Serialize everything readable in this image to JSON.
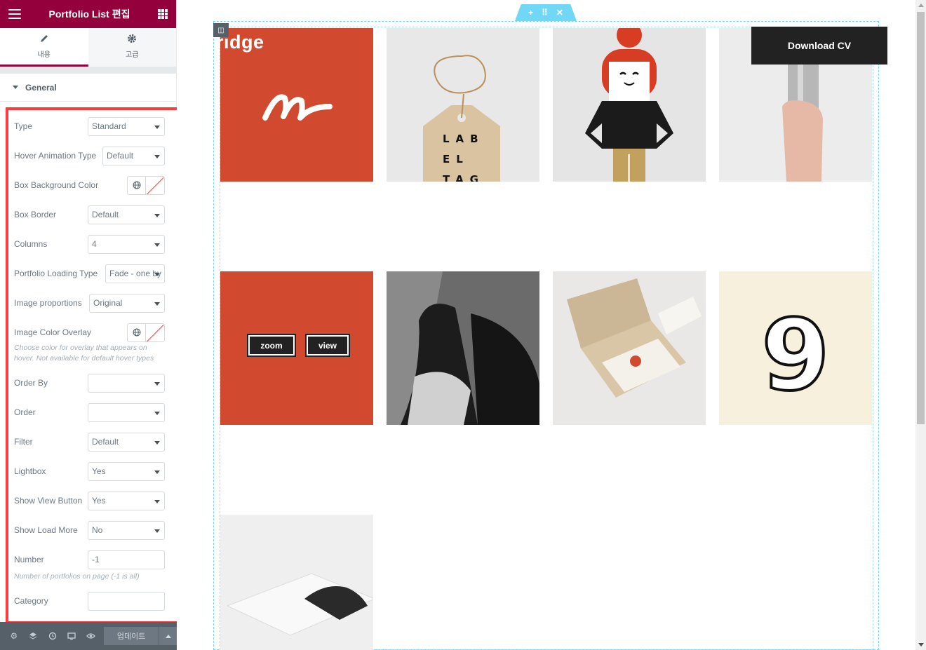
{
  "editor": {
    "title": "Portfolio List 편집",
    "tabs": [
      {
        "label": "내용"
      },
      {
        "label": "고급"
      }
    ],
    "section": {
      "label": "General"
    },
    "controls": {
      "type": {
        "label": "Type",
        "value": "Standard"
      },
      "hover_animation": {
        "label": "Hover Animation Type",
        "value": "Default"
      },
      "box_bg_color": {
        "label": "Box Background Color"
      },
      "box_border": {
        "label": "Box Border",
        "value": "Default"
      },
      "columns": {
        "label": "Columns",
        "value": "4"
      },
      "loading_type": {
        "label": "Portfolio Loading Type",
        "value": "Fade - one by one"
      },
      "image_proportions": {
        "label": "Image proportions",
        "value": "Original"
      },
      "image_color_overlay": {
        "label": "Image Color Overlay",
        "description": "Choose color for overlay that appears on hover. Not available for default hover types"
      },
      "order_by": {
        "label": "Order By",
        "value": ""
      },
      "order": {
        "label": "Order",
        "value": ""
      },
      "filter": {
        "label": "Filter",
        "value": "Default"
      },
      "lightbox": {
        "label": "Lightbox",
        "value": "Yes"
      },
      "show_view_button": {
        "label": "Show View Button",
        "value": "Yes"
      },
      "show_load_more": {
        "label": "Show Load More",
        "value": "No"
      },
      "number": {
        "label": "Number",
        "value": "-1",
        "description": "Number of portfolios on page (-1 is all)"
      },
      "category": {
        "label": "Category",
        "value": ""
      }
    },
    "footer": {
      "icons": [
        "gear-icon",
        "layers-icon",
        "history-icon",
        "responsive-icon",
        "eye-icon"
      ],
      "update_label": "업데이트"
    },
    "highlight_color": "#ff3b3b",
    "brand_color": "#93003c"
  },
  "preview": {
    "logo_text": "ridge",
    "download_cv": "Download CV",
    "tiles": [
      {
        "name": "red-logo-tile"
      },
      {
        "name": "label-tag-tile",
        "tag_lines": [
          "LAB",
          "EL",
          "TAG"
        ]
      },
      {
        "name": "character-illustration-tile"
      },
      {
        "name": "tumbler-hand-tile"
      },
      {
        "name": "red-hover-tile",
        "zoom": "zoom",
        "view": "view"
      },
      {
        "name": "bw-portrait-tile"
      },
      {
        "name": "business-card-box-tile"
      },
      {
        "name": "number-nine-tile",
        "glyph": "9"
      },
      {
        "name": "magazine-tile"
      }
    ]
  }
}
